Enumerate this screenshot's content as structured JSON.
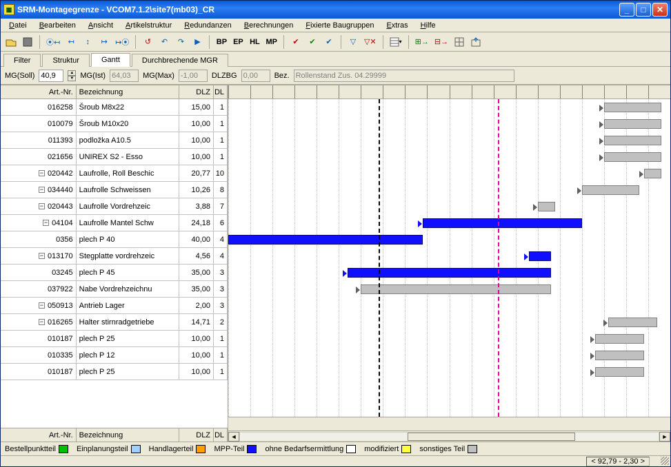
{
  "window": {
    "title": "SRM-Montagegrenze - VCOM7.1.2\\site7(mb03)_CR"
  },
  "menu": {
    "items": [
      "Datei",
      "Bearbeiten",
      "Ansicht",
      "Artikelstruktur",
      "Redundanzen",
      "Berechnungen",
      "Fixierte Baugruppen",
      "Extras",
      "Hilfe"
    ]
  },
  "toolbar": {
    "text_buttons": [
      "BP",
      "EP",
      "HL",
      "MP"
    ]
  },
  "tabs": {
    "items": [
      "Filter",
      "Struktur",
      "Gantt",
      "Durchbrechende MGR"
    ],
    "active": 2
  },
  "params": {
    "mgsoll_label": "MG(Soll)",
    "mgsoll_value": "40,9",
    "mgist_label": "MG(Ist)",
    "mgist_value": "64,03",
    "mgmax_label": "MG(Max)",
    "mgmax_value": "-1,00",
    "dlzbg_label": "DLZBG",
    "dlzbg_value": "0,00",
    "bez_label": "Bez.",
    "bez_value": "Rollenstand Zus. 04.29999"
  },
  "grid": {
    "headers": {
      "art": "Art.-Nr.",
      "bez": "Bezeichnung",
      "dlz": "DLZ",
      "dl": "DL"
    },
    "rows": [
      {
        "art": "016258",
        "bez": "Šroub M8x22",
        "dlz": "15,00",
        "dl": "1",
        "expander": false
      },
      {
        "art": "010079",
        "bez": "Šroub M10x20",
        "dlz": "10,00",
        "dl": "1",
        "expander": false
      },
      {
        "art": "011393",
        "bez": "podložka A10.5",
        "dlz": "10,00",
        "dl": "1",
        "expander": false
      },
      {
        "art": "021656",
        "bez": "UNIREX S2 - Esso",
        "dlz": "10,00",
        "dl": "1",
        "expander": false
      },
      {
        "art": "020442",
        "bez": "Laufrolle, Roll Beschic",
        "dlz": "20,77",
        "dl": "10",
        "expander": true
      },
      {
        "art": "034440",
        "bez": "Laufrolle Schweissen",
        "dlz": "10,26",
        "dl": "8",
        "expander": true
      },
      {
        "art": "020443",
        "bez": "Laufrolle Vordrehzeic",
        "dlz": "3,88",
        "dl": "7",
        "expander": true
      },
      {
        "art": "04104",
        "bez": "Laufrolle Mantel Schw",
        "dlz": "24,18",
        "dl": "6",
        "expander": true
      },
      {
        "art": "0356",
        "bez": "plech P 40",
        "dlz": "40,00",
        "dl": "4",
        "expander": false
      },
      {
        "art": "013170",
        "bez": "Stegplatte vordrehzeic",
        "dlz": "4,56",
        "dl": "4",
        "expander": true
      },
      {
        "art": "03245",
        "bez": "plech P 45",
        "dlz": "35,00",
        "dl": "3",
        "expander": false
      },
      {
        "art": "037922",
        "bez": "Nabe Vordrehzeichnu",
        "dlz": "35,00",
        "dl": "3",
        "expander": false
      },
      {
        "art": "050913",
        "bez": "Antrieb Lager",
        "dlz": "2,00",
        "dl": "3",
        "expander": true
      },
      {
        "art": "016265",
        "bez": "Halter stirnradgetriebe",
        "dlz": "14,71",
        "dl": "2",
        "expander": true
      },
      {
        "art": "010187",
        "bez": "plech P 25",
        "dlz": "10,00",
        "dl": "1",
        "expander": false
      },
      {
        "art": "010335",
        "bez": "plech P 12",
        "dlz": "10,00",
        "dl": "1",
        "expander": false
      },
      {
        "art": "010187",
        "bez": "plech P 25",
        "dlz": "10,00",
        "dl": "1",
        "expander": false
      }
    ]
  },
  "chart_data": {
    "type": "bar",
    "orientation": "horizontal-gantt",
    "x_range": [
      0,
      100
    ],
    "today_line_x": 34,
    "deadline_line_x": 61,
    "tick_interval": 5,
    "rows": [
      {
        "label": "016258",
        "bars": [
          {
            "x0": 85,
            "x1": 98,
            "color": "gray"
          }
        ]
      },
      {
        "label": "010079",
        "bars": [
          {
            "x0": 85,
            "x1": 98,
            "color": "gray"
          }
        ]
      },
      {
        "label": "011393",
        "bars": [
          {
            "x0": 85,
            "x1": 98,
            "color": "gray"
          }
        ]
      },
      {
        "label": "021656",
        "bars": [
          {
            "x0": 85,
            "x1": 98,
            "color": "gray"
          }
        ]
      },
      {
        "label": "020442",
        "bars": [
          {
            "x0": 94,
            "x1": 98,
            "color": "gray"
          }
        ]
      },
      {
        "label": "034440",
        "bars": [
          {
            "x0": 80,
            "x1": 93,
            "color": "gray"
          }
        ]
      },
      {
        "label": "020443",
        "bars": [
          {
            "x0": 70,
            "x1": 74,
            "color": "gray"
          }
        ]
      },
      {
        "label": "04104",
        "bars": [
          {
            "x0": 44,
            "x1": 80,
            "color": "blue"
          }
        ]
      },
      {
        "label": "0356",
        "bars": [
          {
            "x0": 0,
            "x1": 44,
            "color": "blue"
          }
        ]
      },
      {
        "label": "013170",
        "bars": [
          {
            "x0": 68,
            "x1": 73,
            "color": "blue"
          }
        ]
      },
      {
        "label": "03245",
        "bars": [
          {
            "x0": 27,
            "x1": 73,
            "color": "blue"
          }
        ]
      },
      {
        "label": "037922",
        "bars": [
          {
            "x0": 30,
            "x1": 73,
            "color": "gray"
          }
        ]
      },
      {
        "label": "050913",
        "bars": []
      },
      {
        "label": "016265",
        "bars": [
          {
            "x0": 86,
            "x1": 97,
            "color": "gray"
          }
        ]
      },
      {
        "label": "010187",
        "bars": [
          {
            "x0": 83,
            "x1": 94,
            "color": "gray"
          }
        ]
      },
      {
        "label": "010335",
        "bars": [
          {
            "x0": 83,
            "x1": 94,
            "color": "gray"
          }
        ]
      },
      {
        "label": "010187",
        "bars": [
          {
            "x0": 83,
            "x1": 94,
            "color": "gray"
          }
        ]
      }
    ]
  },
  "legend": {
    "items": [
      {
        "label": "Bestellpunktteil",
        "color": "#00c000"
      },
      {
        "label": "Einplanungsteil",
        "color": "#a0d0ff"
      },
      {
        "label": "Handlagerteil",
        "color": "#ffa000"
      },
      {
        "label": "MPP-Teil",
        "color": "#1010ff"
      },
      {
        "label": "ohne Bedarfsermittlung",
        "color": "#ffffff"
      },
      {
        "label": "modifiziert",
        "color": "#ffff40"
      },
      {
        "label": "sonstiges Teil",
        "color": "#c0c0c0"
      }
    ]
  },
  "status": {
    "coords": "< 92,79 - 2,30 >"
  }
}
